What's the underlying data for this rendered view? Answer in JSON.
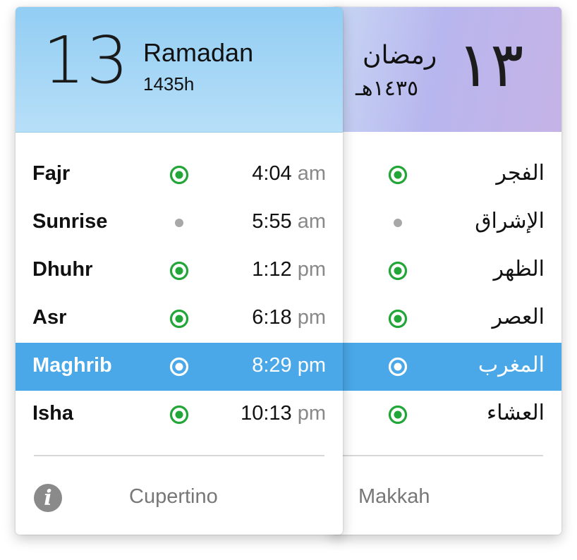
{
  "cupertino": {
    "day": "13",
    "month": "Ramadan",
    "year": "1435h",
    "city": "Cupertino",
    "prayers": [
      {
        "name": "Fajr",
        "time": "4:04",
        "suffix": "am",
        "alert": "on"
      },
      {
        "name": "Sunrise",
        "time": "5:55",
        "suffix": "am",
        "alert": "dot"
      },
      {
        "name": "Dhuhr",
        "time": "1:12",
        "suffix": "pm",
        "alert": "on"
      },
      {
        "name": "Asr",
        "time": "6:18",
        "suffix": "pm",
        "alert": "on"
      },
      {
        "name": "Maghrib",
        "time": "8:29",
        "suffix": "pm",
        "alert": "on",
        "selected": true
      },
      {
        "name": "Isha",
        "time": "10:13",
        "suffix": "pm",
        "alert": "on"
      }
    ]
  },
  "makkah": {
    "day": "١٣",
    "month": "رمضان",
    "year": "١٤٣٥هـ",
    "city": "Makkah",
    "prayers": [
      {
        "name": "الفجر",
        "alert": "on"
      },
      {
        "name": "الإشراق",
        "alert": "dot"
      },
      {
        "name": "الظهر",
        "alert": "on"
      },
      {
        "name": "العصر",
        "alert": "on"
      },
      {
        "name": "المغرب",
        "alert": "on",
        "selected": true
      },
      {
        "name": "العشاء",
        "alert": "on"
      }
    ]
  },
  "info": {
    "icon": "info-icon",
    "glyph": "i"
  },
  "colors": {
    "alert_green": "#21a637",
    "selection_blue": "#4aa8e8",
    "dot_gray": "#a8a8a8"
  }
}
